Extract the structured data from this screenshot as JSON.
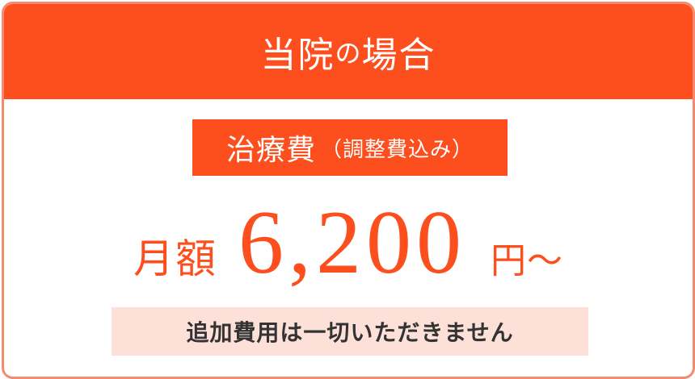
{
  "header": {
    "title_main": "当院",
    "title_particle": "の",
    "title_tail": "場合"
  },
  "fee_label": {
    "main": "治療費",
    "note": "（調整費込み）"
  },
  "price": {
    "prefix": "月額",
    "amount": "6,200",
    "suffix": "円～"
  },
  "footer_note": "追加費用は一切いただきません",
  "colors": {
    "accent": "#fd4e1e",
    "border": "#f58a70",
    "note_background": "#fde1d8",
    "note_text": "#333333"
  }
}
